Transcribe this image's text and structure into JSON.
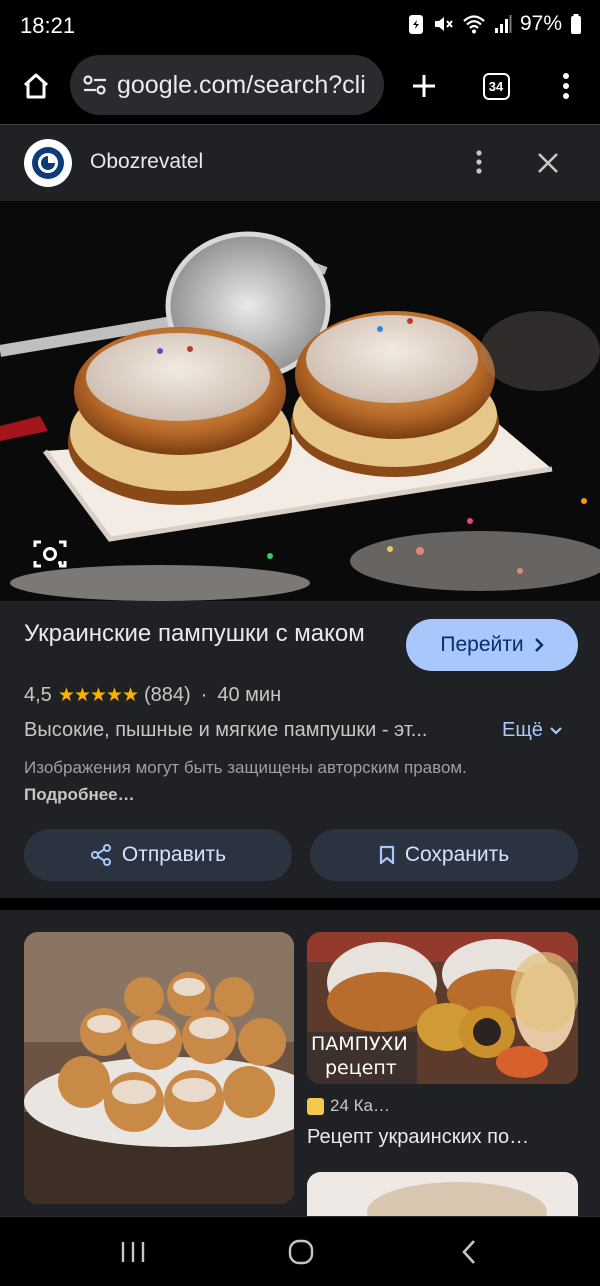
{
  "status_bar": {
    "time": "18:21",
    "battery": "97%",
    "icons": [
      "data-saver-icon",
      "mute-icon",
      "wifi-icon",
      "signal-icon",
      "battery-icon"
    ]
  },
  "browser": {
    "url": "google.com/search?cli",
    "tab_count": "34",
    "icons": [
      "home-icon",
      "site-settings-icon",
      "plus-icon",
      "tabs-icon",
      "more-vert-icon"
    ]
  },
  "panel": {
    "source_name": "Obozrevatel",
    "title": "Украинские пампушки с маком",
    "go_button": "Перейти",
    "rating": "4,5",
    "rating_value": 4.5,
    "stars": "★★★★★",
    "review_count": "(884)",
    "separator": "·",
    "duration": "40 мин",
    "description": "Высокие, пышные и мягкие пампушки - эт...",
    "more_link": "Ещё",
    "copyright_text": "Изображения могут быть защищены авторским правом.",
    "copyright_link": "Подробнее…",
    "share_button": "Отправить",
    "save_button": "Сохранить"
  },
  "results": {
    "result_2_overlay_line1": "ПАМПУХИ",
    "result_2_overlay_line2": "рецепт",
    "result_2_source": "24 Ка…",
    "result_2_title": "Рецепт украинских по…"
  },
  "colors": {
    "accent": "#a8c7fa",
    "panel_bg": "#202124",
    "star": "#f6b400"
  }
}
